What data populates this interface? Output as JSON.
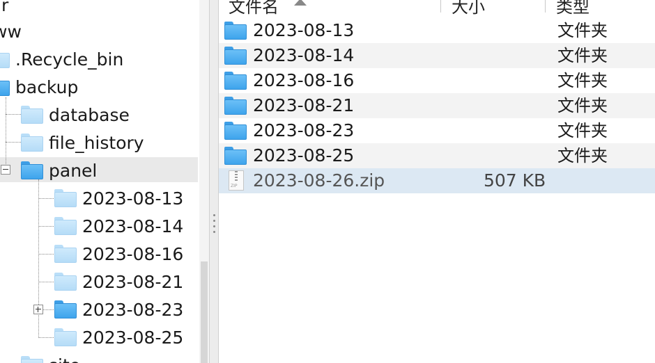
{
  "tree": {
    "partial_top_label": ".r",
    "root_label": "ww",
    "recycle_label": ".Recycle_bin",
    "backup_label": "backup",
    "database_label": "database",
    "file_history_label": "file_history",
    "panel_label": "panel",
    "panel_children": [
      "2023-08-13",
      "2023-08-14",
      "2023-08-16",
      "2023-08-21",
      "2023-08-23",
      "2023-08-25"
    ],
    "partial_bottom_label": "site"
  },
  "list": {
    "columns": {
      "name": "文件名",
      "size": "大小",
      "type": "类型"
    },
    "rows": [
      {
        "name": "2023-08-13",
        "size": "",
        "type": "文件夹",
        "icon": "folder-icon"
      },
      {
        "name": "2023-08-14",
        "size": "",
        "type": "文件夹",
        "icon": "folder-icon"
      },
      {
        "name": "2023-08-16",
        "size": "",
        "type": "文件夹",
        "icon": "folder-icon"
      },
      {
        "name": "2023-08-21",
        "size": "",
        "type": "文件夹",
        "icon": "folder-icon"
      },
      {
        "name": "2023-08-23",
        "size": "",
        "type": "文件夹",
        "icon": "folder-icon"
      },
      {
        "name": "2023-08-25",
        "size": "",
        "type": "文件夹",
        "icon": "folder-icon"
      },
      {
        "name": "2023-08-26.zip",
        "size": "507 KB",
        "type": "",
        "icon": "zip-file-icon"
      }
    ]
  },
  "colors": {
    "selection": "#dce8f3",
    "tree_selection": "#e9e9e9",
    "folder_blue": "#3ea4ec"
  }
}
